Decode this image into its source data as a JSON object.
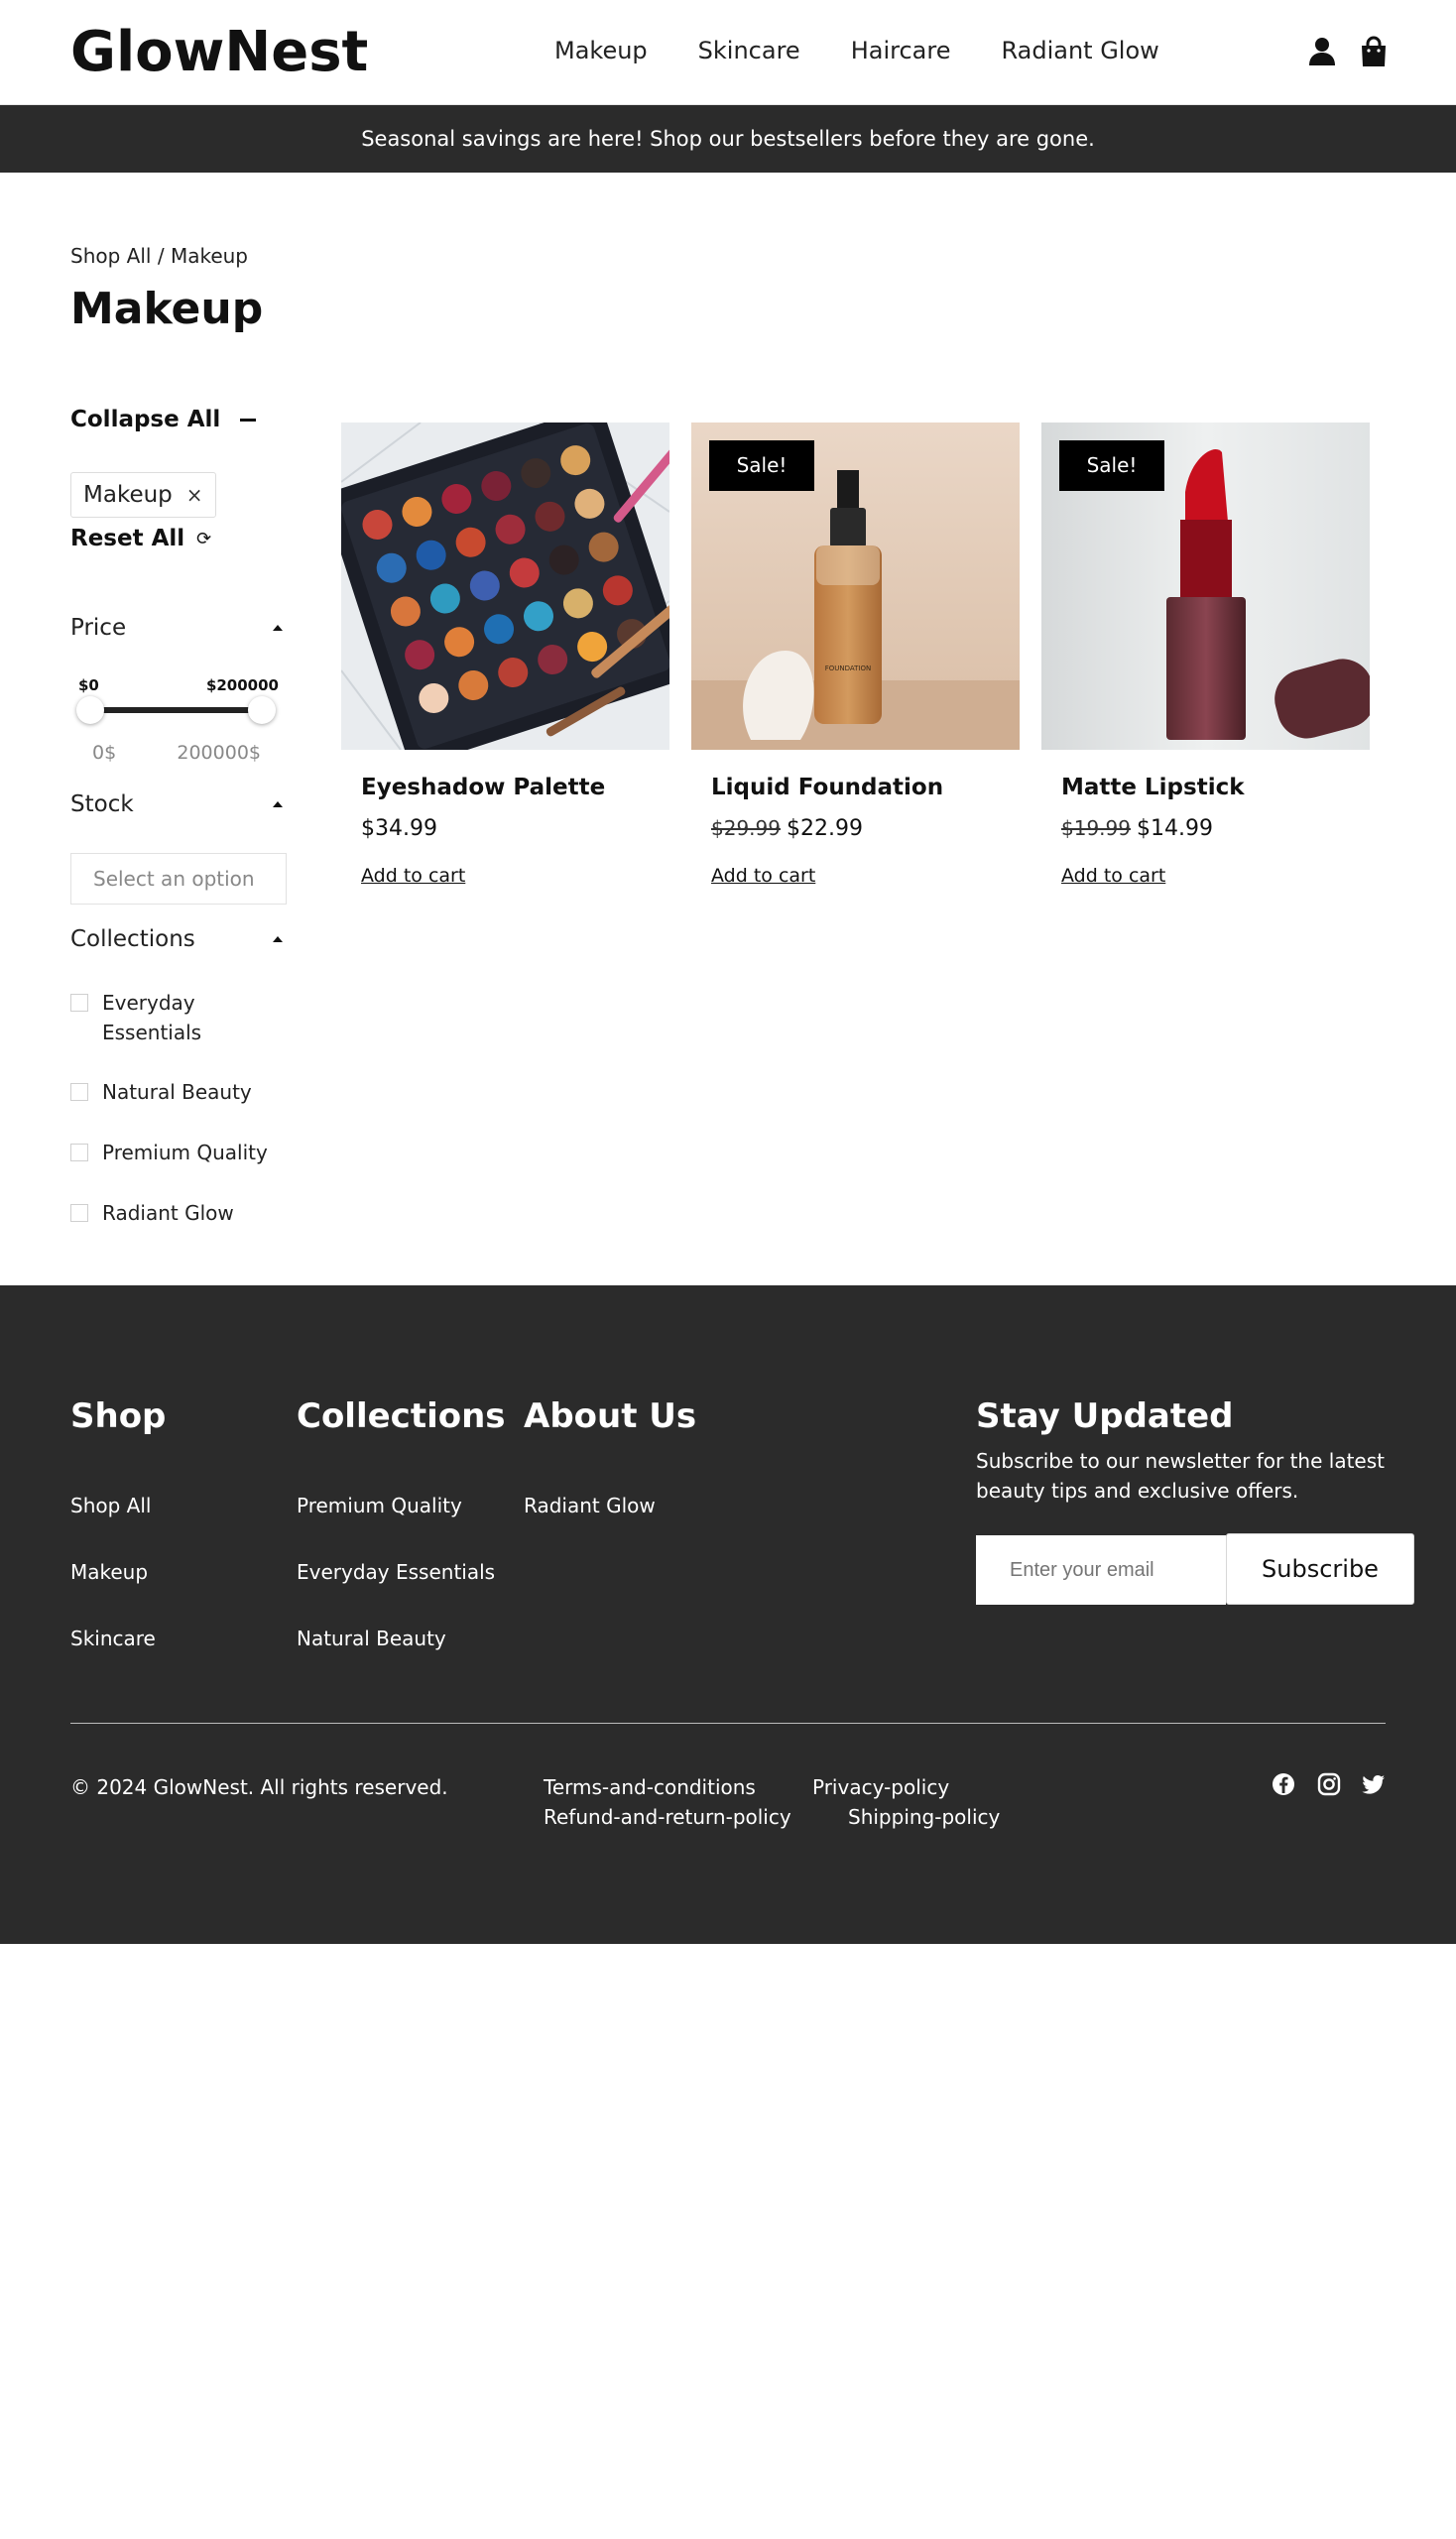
{
  "header": {
    "logo": "GlowNest",
    "nav": [
      "Makeup",
      "Skincare",
      "Haircare",
      "Radiant Glow"
    ],
    "icons": [
      "user-icon",
      "shopping-bag-icon"
    ]
  },
  "announcement": "Seasonal savings are here! Shop our bestsellers before they are gone.",
  "breadcrumb": {
    "root": "Shop All",
    "separator": "/",
    "current": "Makeup"
  },
  "page_title": "Makeup",
  "filters": {
    "collapse_all": "Collapse All",
    "active_chip": "Makeup",
    "chip_remove": "×",
    "reset_all": "Reset All",
    "price": {
      "label": "Price",
      "min_label": "$0",
      "max_label": "$200000",
      "range_min": "0$",
      "range_max": "200000$"
    },
    "stock": {
      "label": "Stock",
      "placeholder": "Select an option"
    },
    "collections": {
      "label": "Collections",
      "options": [
        "Everyday Essentials",
        "Natural Beauty",
        "Premium Quality",
        "Radiant Glow"
      ]
    }
  },
  "products": [
    {
      "name": "Eyeshadow Palette",
      "old_price": "",
      "price": "$34.99",
      "sale_badge": "",
      "cta": "Add to cart"
    },
    {
      "name": "Liquid Foundation",
      "old_price": "$29.99",
      "price": "$22.99",
      "sale_badge": "Sale!",
      "cta": "Add to cart"
    },
    {
      "name": "Matte Lipstick",
      "old_price": "$19.99",
      "price": "$14.99",
      "sale_badge": "Sale!",
      "cta": "Add to cart"
    }
  ],
  "footer": {
    "shop": {
      "title": "Shop",
      "links": [
        "Shop All",
        "Makeup",
        "Skincare"
      ]
    },
    "collections": {
      "title": "Collections",
      "links": [
        "Premium Quality",
        "Everyday Essentials",
        "Natural Beauty"
      ]
    },
    "about": {
      "title": "About Us",
      "links": [
        "Radiant Glow"
      ]
    },
    "newsletter": {
      "title": "Stay Updated",
      "text": "Subscribe to our newsletter for the latest beauty tips and exclusive offers.",
      "placeholder": "Enter your email",
      "button": "Subscribe"
    },
    "copyright": "© 2024 GlowNest. All rights reserved.",
    "legal": [
      "Terms-and-conditions",
      "Privacy-policy",
      "Refund-and-return-policy",
      "Shipping-policy"
    ],
    "social": [
      "facebook-icon",
      "instagram-icon",
      "twitter-icon"
    ]
  },
  "colors": {
    "dark": "#2b2b2b",
    "black": "#000000",
    "white": "#ffffff"
  }
}
